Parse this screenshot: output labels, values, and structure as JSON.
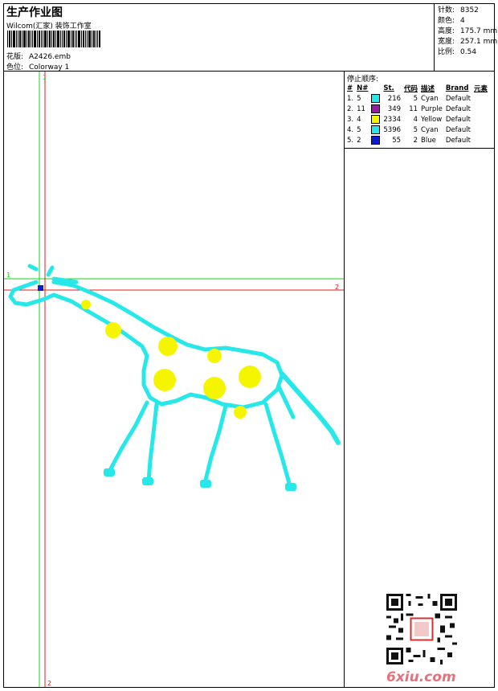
{
  "header": {
    "title": "生产作业图",
    "subtitle": "Wilcom(汇家) 装饰工作室",
    "design_label": "花版:",
    "design_value": "A2426.emb",
    "colorway_label": "色位:",
    "colorway_value": "Colorway 1"
  },
  "meta": [
    {
      "label": "针数:",
      "value": "8352"
    },
    {
      "label": "颜色:",
      "value": "4"
    },
    {
      "label": "高度:",
      "value": "175.7 mm"
    },
    {
      "label": "宽度:",
      "value": "257.1 mm"
    },
    {
      "label": "比例:",
      "value": "0.54"
    }
  ],
  "stop_sequence": {
    "title": "停止顺序:",
    "columns": [
      "#",
      "N#",
      "St.",
      "代码",
      "描述",
      "Brand",
      "元素"
    ],
    "rows": [
      {
        "idx": "1.",
        "n": "5",
        "color": "#27e8e8",
        "st": "216",
        "code": "5",
        "desc": "Cyan",
        "brand": "Default"
      },
      {
        "idx": "2.",
        "n": "11",
        "color": "#9a1aa8",
        "st": "349",
        "code": "11",
        "desc": "Purple",
        "brand": "Default"
      },
      {
        "idx": "3.",
        "n": "4",
        "color": "#f5f500",
        "st": "2334",
        "code": "4",
        "desc": "Yellow",
        "brand": "Default"
      },
      {
        "idx": "4.",
        "n": "5",
        "color": "#27e8e8",
        "st": "5396",
        "code": "5",
        "desc": "Cyan",
        "brand": "Default"
      },
      {
        "idx": "5.",
        "n": "2",
        "color": "#0c1ad8",
        "st": "55",
        "code": "2",
        "desc": "Blue",
        "brand": "Default"
      }
    ]
  },
  "guides": {
    "h1": "1",
    "h2": "2",
    "v1": "1",
    "v2": "2"
  },
  "colors": {
    "cyan": "#27e8e8",
    "yellow": "#f5f500",
    "guide_green": "#19d219",
    "guide_red": "#e01a1a"
  },
  "watermark": "6xiu.com"
}
